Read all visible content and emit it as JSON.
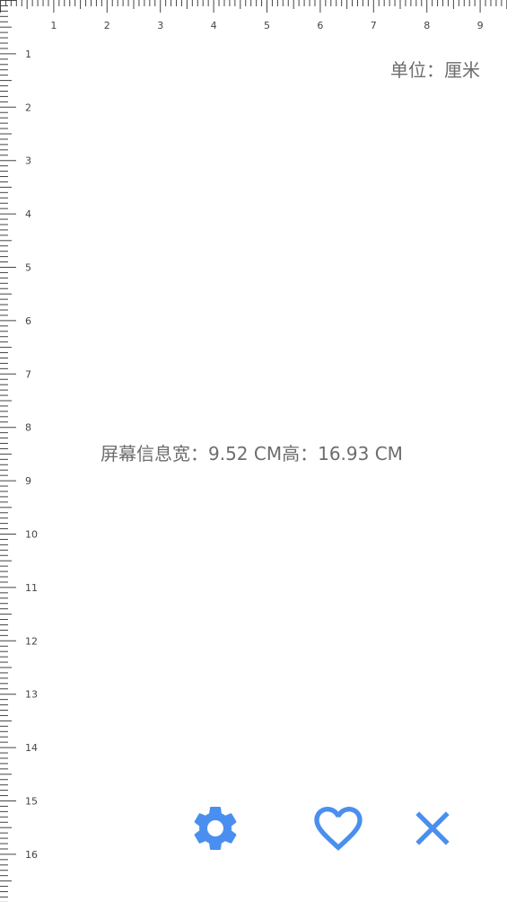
{
  "ruler": {
    "top_labels": [
      "1",
      "2",
      "3",
      "4",
      "5",
      "6",
      "7",
      "8",
      "9"
    ],
    "left_labels": [
      "1",
      "2",
      "3",
      "4",
      "5",
      "6",
      "7",
      "8",
      "9",
      "10",
      "11",
      "12",
      "13",
      "14",
      "15",
      "16"
    ]
  },
  "unit": {
    "label": "单位：厘米"
  },
  "screen_info": {
    "text": "屏幕信息宽：9.52 CM高：16.93 CM"
  },
  "colors": {
    "accent": "#4a8ff0",
    "text": "#6d6d6d",
    "ruler": "#444444"
  },
  "toolbar": {
    "settings": {
      "icon": "gear-icon"
    },
    "favorite": {
      "icon": "heart-outline-icon"
    },
    "close": {
      "icon": "close-icon"
    }
  }
}
